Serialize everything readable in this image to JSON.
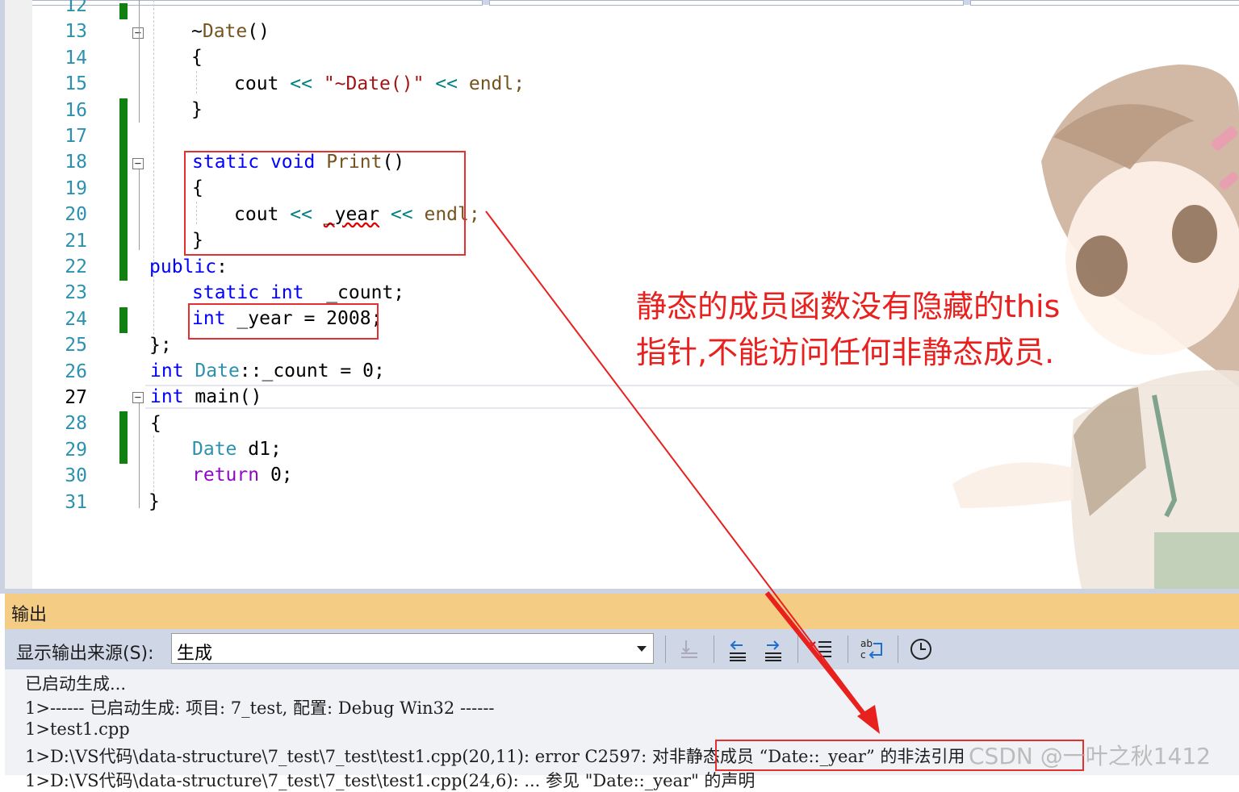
{
  "editor": {
    "line_numbers": [
      "12",
      "13",
      "14",
      "15",
      "16",
      "17",
      "18",
      "19",
      "20",
      "21",
      "22",
      "23",
      "24",
      "25",
      "26",
      "27",
      "28",
      "29",
      "30",
      "31"
    ],
    "code": {
      "l13": {
        "tilde": "~",
        "name": "Date",
        "paren": "()"
      },
      "l14": "{",
      "l15": {
        "cout": "cout",
        "op1": "<<",
        "str": "\"~Date()\"",
        "op2": "<<",
        "endl": "endl;"
      },
      "l16": "}",
      "l18": {
        "static": "static",
        "void": "void",
        "name": "Print",
        "paren": "()"
      },
      "l19": "{",
      "l20": {
        "cout": "cout",
        "op1": "<<",
        "var": "_year",
        "op2": "<<",
        "endl": "endl;"
      },
      "l21": "}",
      "l22": {
        "public": "public",
        ":": ":"
      },
      "l23": {
        "static": "static",
        "int": "int",
        "var": "_count;"
      },
      "l24": {
        "int": "int",
        "rest": "_year = 2008;"
      },
      "l25": "};",
      "l26": {
        "int": "int",
        "cls": "Date",
        "rest": "::_count = 0;"
      },
      "l27": {
        "int": "int",
        "rest": "main()"
      },
      "l28": "{",
      "l29": {
        "cls": "Date",
        "rest": "d1;"
      },
      "l30": {
        "ret": "return",
        "rest": "0;"
      },
      "l31": "}"
    }
  },
  "annotation": [
    "静态的成员函数没有隐藏的this",
    "指针,不能访问任何非静态成员."
  ],
  "output": {
    "title": "输出",
    "source_label": "显示输出来源(S):",
    "source_value": "生成",
    "lines": [
      "已启动生成...",
      "1>------ 已启动生成: 项目: 7_test, 配置: Debug Win32 ------",
      "1>test1.cpp",
      "1>D:\\VS代码\\data-structure\\7_test\\7_test\\test1.cpp(20,11): error C2597: ",
      "1>D:\\VS代码\\data-structure\\7_test\\7_test\\test1.cpp(24,6): ... 参见 \"Date::_year\" 的声明"
    ],
    "error_message": "对非静态成员 “Date::_year” 的非法引用"
  },
  "watermark": "CSDN @一叶之秋1412",
  "colors": {
    "keyword": "#0000ff",
    "type": "#2b91af",
    "string": "#a31515",
    "annotation": "#e8201e",
    "output_header": "#f5cc84"
  }
}
